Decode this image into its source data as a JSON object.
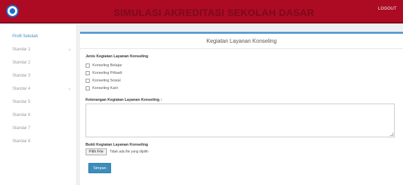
{
  "header": {
    "title": "SIMULASI AKREDITASI SEKOLAH DASAR",
    "logout_label": "LOGOUT",
    "logo_icon": "school-logo-icon"
  },
  "sidebar": {
    "items": [
      {
        "label": "Profil Sekolah",
        "has_submenu": false,
        "active": true
      },
      {
        "label": "Standar 1",
        "has_submenu": true,
        "active": false
      },
      {
        "label": "Standar 2",
        "has_submenu": false,
        "active": false
      },
      {
        "label": "Standar 3",
        "has_submenu": false,
        "active": false
      },
      {
        "label": "Standar 4",
        "has_submenu": true,
        "active": false
      },
      {
        "label": "Standar 5",
        "has_submenu": false,
        "active": false
      },
      {
        "label": "Standar 6",
        "has_submenu": false,
        "active": false
      },
      {
        "label": "Standar 7",
        "has_submenu": false,
        "active": false
      },
      {
        "label": "Standar 8",
        "has_submenu": false,
        "active": false
      }
    ],
    "chevron_glyph": "‹"
  },
  "panel": {
    "title": "Kegiatan Layanan Konseling",
    "jenis_label": "Jenis Kegiatan Layanan Konseling",
    "options": [
      {
        "label": "Konseling Belajar",
        "checked": false
      },
      {
        "label": "Konseling Pribadi",
        "checked": false
      },
      {
        "label": "Konseling Sosial",
        "checked": false
      },
      {
        "label": "Konseling Karir",
        "checked": false
      }
    ],
    "keterangan_label": "Keterangan Kegiatan Layanan Konseling :",
    "keterangan_value": "",
    "bukti_label": "Bukti Kegiatan Layanan Konseling",
    "file_button_label": "Pilih File",
    "file_status": "Tidak ada file yang dipilih",
    "submit_label": "Simpan"
  },
  "colors": {
    "header_bg": "#ad0a24",
    "accent": "#3c8dbc",
    "panel_top_border": "#5b9bd5"
  }
}
